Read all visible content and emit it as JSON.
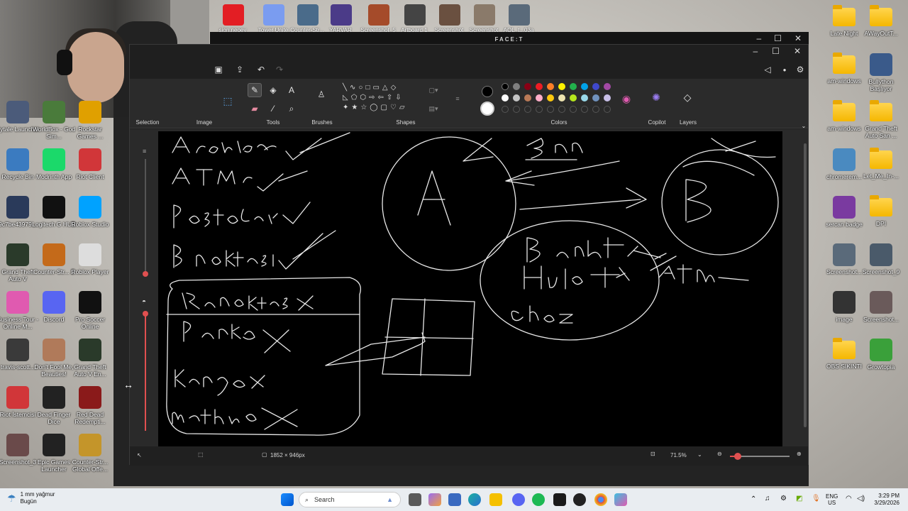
{
  "window": {
    "faceit_logo": "FACE:T"
  },
  "top_strip": [
    {
      "label": "sign.neoey",
      "color": "#e31e24"
    },
    {
      "label": "Tower Unite",
      "color": "#7a9cf0"
    },
    {
      "label": "Counter-Str...",
      "color": "#4a6b8a"
    },
    {
      "label": "YARVAR",
      "color": "#4b3b88"
    },
    {
      "label": "Screenshot_5",
      "color": "#a54b2a"
    },
    {
      "label": "Artboard 1",
      "color": "#444444"
    },
    {
      "label": "Screenshot",
      "color": "#6a5040"
    },
    {
      "label": "Screenshot",
      "color": "#8a7a6a"
    },
    {
      "label": "AOL_t...03a",
      "color": "#5a6a7a"
    }
  ],
  "desktop_left": [
    {
      "label": "Hytale Launcher",
      "color": "#4b5b7a"
    },
    {
      "label": "WorldBox - God Sim...",
      "color": "#4a7b3b"
    },
    {
      "label": "Rockstar Games ...",
      "color": "#e0a000"
    },
    {
      "label": "Recycle Bin",
      "color": "#3b7bc0"
    },
    {
      "label": "Modrinth App",
      "color": "#1bd96a"
    },
    {
      "label": "Riot Client",
      "color": "#d13639"
    },
    {
      "label": "9c7be43979...",
      "color": "#2a3a5a"
    },
    {
      "label": "Logitech G HUB",
      "color": "#111111"
    },
    {
      "label": "Roblox Studio",
      "color": "#00a2ff"
    },
    {
      "label": "Grand Theft Auto V",
      "color": "#2a3a2a"
    },
    {
      "label": "Counter-Str... 2",
      "color": "#c46a1a"
    },
    {
      "label": "Roblox Player",
      "color": "#dddddd"
    },
    {
      "label": "Business Tour - Online M...",
      "color": "#e05ab0"
    },
    {
      "label": "Discord",
      "color": "#5865f2"
    },
    {
      "label": "Pro Soccer Online",
      "color": "#111111"
    },
    {
      "label": "travis-scott...",
      "color": "#3a3a3a"
    },
    {
      "label": "Don't Fool Me, Beauties!",
      "color": "#b07a5a"
    },
    {
      "label": "Grand Theft Auto V En...",
      "color": "#2a3a2a"
    },
    {
      "label": "Riot İstemcisi",
      "color": "#d13639"
    },
    {
      "label": "Dead Finger Dice",
      "color": "#222222"
    },
    {
      "label": "Red Dead Redempti...",
      "color": "#8a1a1a"
    },
    {
      "label": "Screenshot_3",
      "color": "#6a4a4a"
    },
    {
      "label": "Epic Games Launcher",
      "color": "#222222"
    },
    {
      "label": "Counter-Str... Global Offe...",
      "color": "#c4952a"
    }
  ],
  "desktop_right": [
    {
      "label": "Late Night",
      "type": "folder"
    },
    {
      "label": "AWayOutT...",
      "type": "folder"
    },
    {
      "label": "am-windows",
      "type": "folder"
    },
    {
      "label": "Bullython Başlıyor",
      "type": "image",
      "color": "#3a5a8a"
    },
    {
      "label": "am-windows",
      "type": "folder"
    },
    {
      "label": "Grand Theft Auto San ...",
      "type": "folder"
    },
    {
      "label": "chromerem...",
      "type": "image",
      "color": "#4a8ac0"
    },
    {
      "label": "Let_Me_In-...",
      "type": "folder"
    },
    {
      "label": "sercan badge",
      "type": "image",
      "color": "#7a3aa0"
    },
    {
      "label": "DPI",
      "type": "folder"
    },
    {
      "label": "Screenshot...",
      "type": "image",
      "color": "#5a6a7a"
    },
    {
      "label": "Screenshot_9",
      "type": "image",
      "color": "#4a5a6a"
    },
    {
      "label": "image",
      "type": "image",
      "color": "#333333"
    },
    {
      "label": "Screenshot...",
      "type": "image",
      "color": "#6a5a5a"
    },
    {
      "label": "OBS SIKINTI",
      "type": "folder"
    },
    {
      "label": "Growtopia",
      "type": "image",
      "color": "#3aa03a"
    }
  ],
  "paint": {
    "ribbon_groups": {
      "selection": "Selection",
      "image": "Image",
      "tools": "Tools",
      "brushes": "Brushes",
      "shapes": "Shapes",
      "colors": "Colors",
      "copilot": "Copilot",
      "layers": "Layers"
    },
    "palette_row1": [
      "#000000",
      "#7f7f7f",
      "#880015",
      "#ed1c24",
      "#ff7f27",
      "#fff200",
      "#22b14c",
      "#00a2e8",
      "#3f48cc",
      "#a349a4"
    ],
    "palette_row2": [
      "#ffffff",
      "#c3c3c3",
      "#b97a57",
      "#ffaec9",
      "#ffc90e",
      "#efe4b0",
      "#b5e61d",
      "#99d9ea",
      "#7092be",
      "#c8bfe7"
    ],
    "primary_color": "#000000",
    "secondary_color": "#ffffff",
    "canvas_size": "1852 × 946px",
    "zoom": "71.5%"
  },
  "taskbar": {
    "search_placeholder": "Search",
    "weather_temp": "1 mm yağmur",
    "weather_desc": "Bugün",
    "lang": "ENG",
    "region": "US",
    "time": "3:29 PM",
    "date": "3/29/2026"
  }
}
